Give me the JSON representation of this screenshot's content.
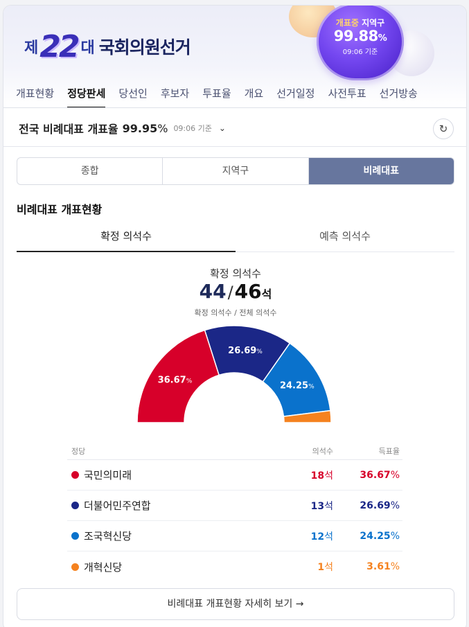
{
  "header": {
    "logo_prefix": "제",
    "logo_number": "22",
    "logo_suffix": "대",
    "title": "국회의원선거",
    "badge": {
      "label_highlight": "개표중",
      "label_rest": "지역구",
      "percent": "99.88",
      "percent_unit": "%",
      "time": "09:06 기준"
    }
  },
  "nav": {
    "tabs": [
      {
        "label": "개표현황",
        "active": false
      },
      {
        "label": "정당판세",
        "active": true
      },
      {
        "label": "당선인",
        "active": false
      },
      {
        "label": "후보자",
        "active": false
      },
      {
        "label": "투표율",
        "active": false
      },
      {
        "label": "개요",
        "active": false
      },
      {
        "label": "선거일정",
        "active": false
      },
      {
        "label": "사전투표",
        "active": false
      },
      {
        "label": "선거방송",
        "active": false
      }
    ]
  },
  "rate": {
    "title": "전국 비례대표 개표율",
    "value": "99.95",
    "unit": "%",
    "time": "09:06 기준",
    "chevron": "⌄",
    "refresh_icon": "↻"
  },
  "segments": [
    {
      "label": "종합",
      "active": false
    },
    {
      "label": "지역구",
      "active": false
    },
    {
      "label": "비례대표",
      "active": true
    }
  ],
  "section_title": "비례대표 개표현황",
  "subtabs": [
    {
      "label": "확정 의석수",
      "active": true
    },
    {
      "label": "예측 의석수",
      "active": false
    }
  ],
  "seats": {
    "caption": "확정 의석수",
    "confirmed": "44",
    "slash": "/",
    "total": "46",
    "unit": "석",
    "sub": "확정 의석수 / 전체 의석수"
  },
  "chart_data": {
    "type": "pie",
    "shape": "semicircle-donut",
    "categories": [
      "국민의미래",
      "더불어민주연합",
      "조국혁신당",
      "개혁신당"
    ],
    "values": [
      36.67,
      26.69,
      24.25,
      3.61
    ],
    "labels": [
      "36.67",
      "26.69",
      "24.25",
      ""
    ],
    "label_unit": "%",
    "colors": [
      "#d7002a",
      "#1b2787",
      "#0a72cc",
      "#f5821f"
    ]
  },
  "table": {
    "headers": {
      "party": "정당",
      "seats": "의석수",
      "rate": "득표율"
    },
    "rows": [
      {
        "party": "국민의미래",
        "seats": "18",
        "seats_unit": "석",
        "rate": "36.67",
        "rate_unit": "%",
        "color": "#d7002a"
      },
      {
        "party": "더불어민주연합",
        "seats": "13",
        "seats_unit": "석",
        "rate": "26.69",
        "rate_unit": "%",
        "color": "#1b2787"
      },
      {
        "party": "조국혁신당",
        "seats": "12",
        "seats_unit": "석",
        "rate": "24.25",
        "rate_unit": "%",
        "color": "#0a72cc"
      },
      {
        "party": "개혁신당",
        "seats": "1",
        "seats_unit": "석",
        "rate": "3.61",
        "rate_unit": "%",
        "color": "#f5821f"
      }
    ]
  },
  "more_button": {
    "label": "비례대표 개표현황 자세히 보기",
    "arrow": "→"
  }
}
